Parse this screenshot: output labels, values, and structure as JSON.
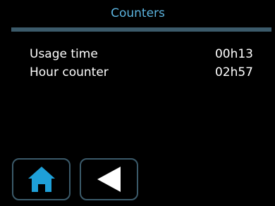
{
  "header": {
    "title": "Counters"
  },
  "counters": [
    {
      "label": "Usage time",
      "value": "00h13"
    },
    {
      "label": "Hour counter",
      "value": "02h57"
    }
  ],
  "footer": {
    "buttons": [
      {
        "icon": "home-icon",
        "color": "#1ea0d8"
      },
      {
        "icon": "back-arrow-icon",
        "color": "#ffffff"
      }
    ]
  },
  "colors": {
    "background": "#000000",
    "title": "#5bb3de",
    "accent_bar": "#3b5a6a",
    "text": "#ffffff",
    "button_border": "#3b5a6a"
  }
}
